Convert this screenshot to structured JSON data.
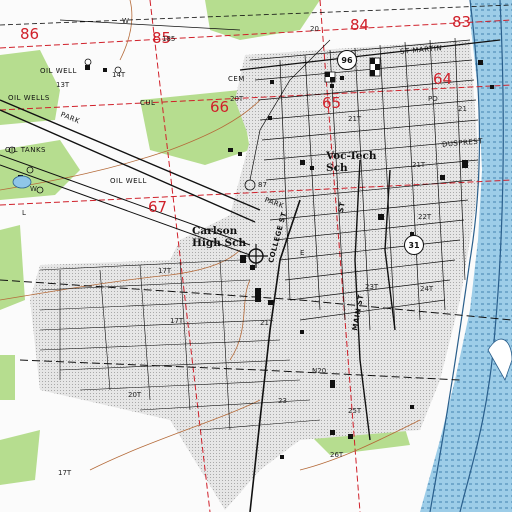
{
  "map": {
    "places": {
      "school": "Carlson High Sch",
      "vocational": "Voc-Tech Sch"
    },
    "route_shields": {
      "r96": "96",
      "r31": "31"
    },
    "section_numbers": {
      "s86": "86",
      "s85": "85",
      "s84": "84",
      "s83": "83",
      "s64": "64",
      "s65": "65",
      "s66": "66",
      "s67": "67"
    },
    "streets": {
      "college": "COLLEGE ST",
      "main": "MAIN ST",
      "st_upper": "ST",
      "st_martin": "ST MARTIN",
      "dusprest": "DUSPREST",
      "park": "PARK",
      "cem": "CEM",
      "oil_well": "OIL WELL",
      "oil_wells": "OIL WELLS",
      "oil_tanks": "OIL TANKS",
      "cul": "CUL"
    },
    "small_labels": {
      "t185": "185",
      "t20a": "20",
      "t20b": "20T",
      "t21a": "21T",
      "t21b": "21T",
      "t22": "22T",
      "t23": "23T",
      "t24": "24T",
      "t25": "25T",
      "t26": "26T",
      "t17a": "17T",
      "t17b": "17T",
      "t17c": "17T",
      "tn20": "N20",
      "t20c": "20T",
      "t23b": "23",
      "t21c": "21T",
      "t21d": "21",
      "tpo": "PO",
      "t_w": "W",
      "t_e": "E",
      "t13": "13T",
      "t14": "14T",
      "t87": "87",
      "tl": "L"
    },
    "colors": {
      "urban_tint": "#d8d8d8",
      "woodland": "#b6dd8f",
      "water": "#8fc6e8",
      "grid_red": "#d0202a",
      "road": "#111111"
    }
  }
}
